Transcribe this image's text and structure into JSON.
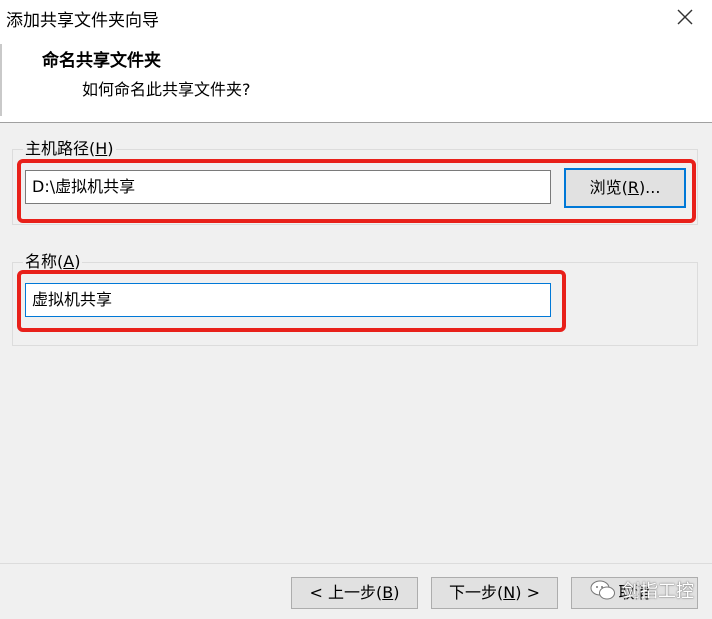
{
  "window": {
    "title": "添加共享文件夹向导",
    "close_label": "close"
  },
  "wizard": {
    "heading": "命名共享文件夹",
    "subheading": "如何命名此共享文件夹?"
  },
  "host_path": {
    "label_prefix": "主机路径(",
    "label_key": "H",
    "label_suffix": ")",
    "value": "D:\\虚拟机共享",
    "browse_prefix": "浏览(",
    "browse_key": "R",
    "browse_suffix": ")..."
  },
  "name": {
    "label_prefix": "名称(",
    "label_key": "A",
    "label_suffix": ")",
    "value": "虚拟机共享"
  },
  "footer": {
    "back_prefix": "< 上一步(",
    "back_key": "B",
    "back_suffix": ")",
    "next_prefix": "下一步(",
    "next_key": "N",
    "next_suffix": ") >",
    "cancel_label": "取消"
  },
  "watermark": {
    "text": "剑指工控"
  },
  "colors": {
    "highlight": "#e8201a",
    "focus": "#0078d7"
  }
}
